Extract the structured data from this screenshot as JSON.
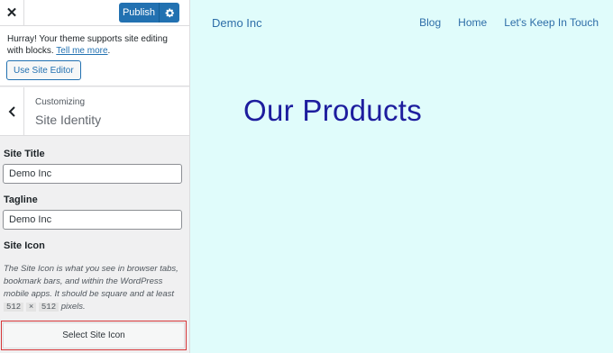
{
  "sidebar": {
    "close_symbol": "✕",
    "publish_label": "Publish",
    "notice": {
      "text": "Hurray! Your theme supports site editing with blocks.",
      "link": "Tell me more",
      "button": "Use Site Editor"
    },
    "section": {
      "label": "Customizing",
      "title": "Site Identity"
    },
    "fields": {
      "site_title_label": "Site Title",
      "site_title_value": "Demo Inc",
      "tagline_label": "Tagline",
      "tagline_value": "Demo Inc",
      "site_icon_label": "Site Icon"
    },
    "description": {
      "text": "The Site Icon is what you see in browser tabs, bookmark bars, and within the WordPress mobile apps. It should be square and at least",
      "width_px": "512",
      "times": "×",
      "height_px": "512",
      "suffix": "pixels."
    },
    "select_icon_button": "Select Site Icon"
  },
  "preview": {
    "site_name": "Demo Inc",
    "nav": [
      "Blog",
      "Home",
      "Let's Keep In Touch"
    ],
    "heading": "Our Products"
  },
  "colors": {
    "accent": "#2271b1",
    "preview_bg": "#e0fcfb",
    "heading": "#1d1d9e",
    "highlight_border": "#d63638"
  }
}
